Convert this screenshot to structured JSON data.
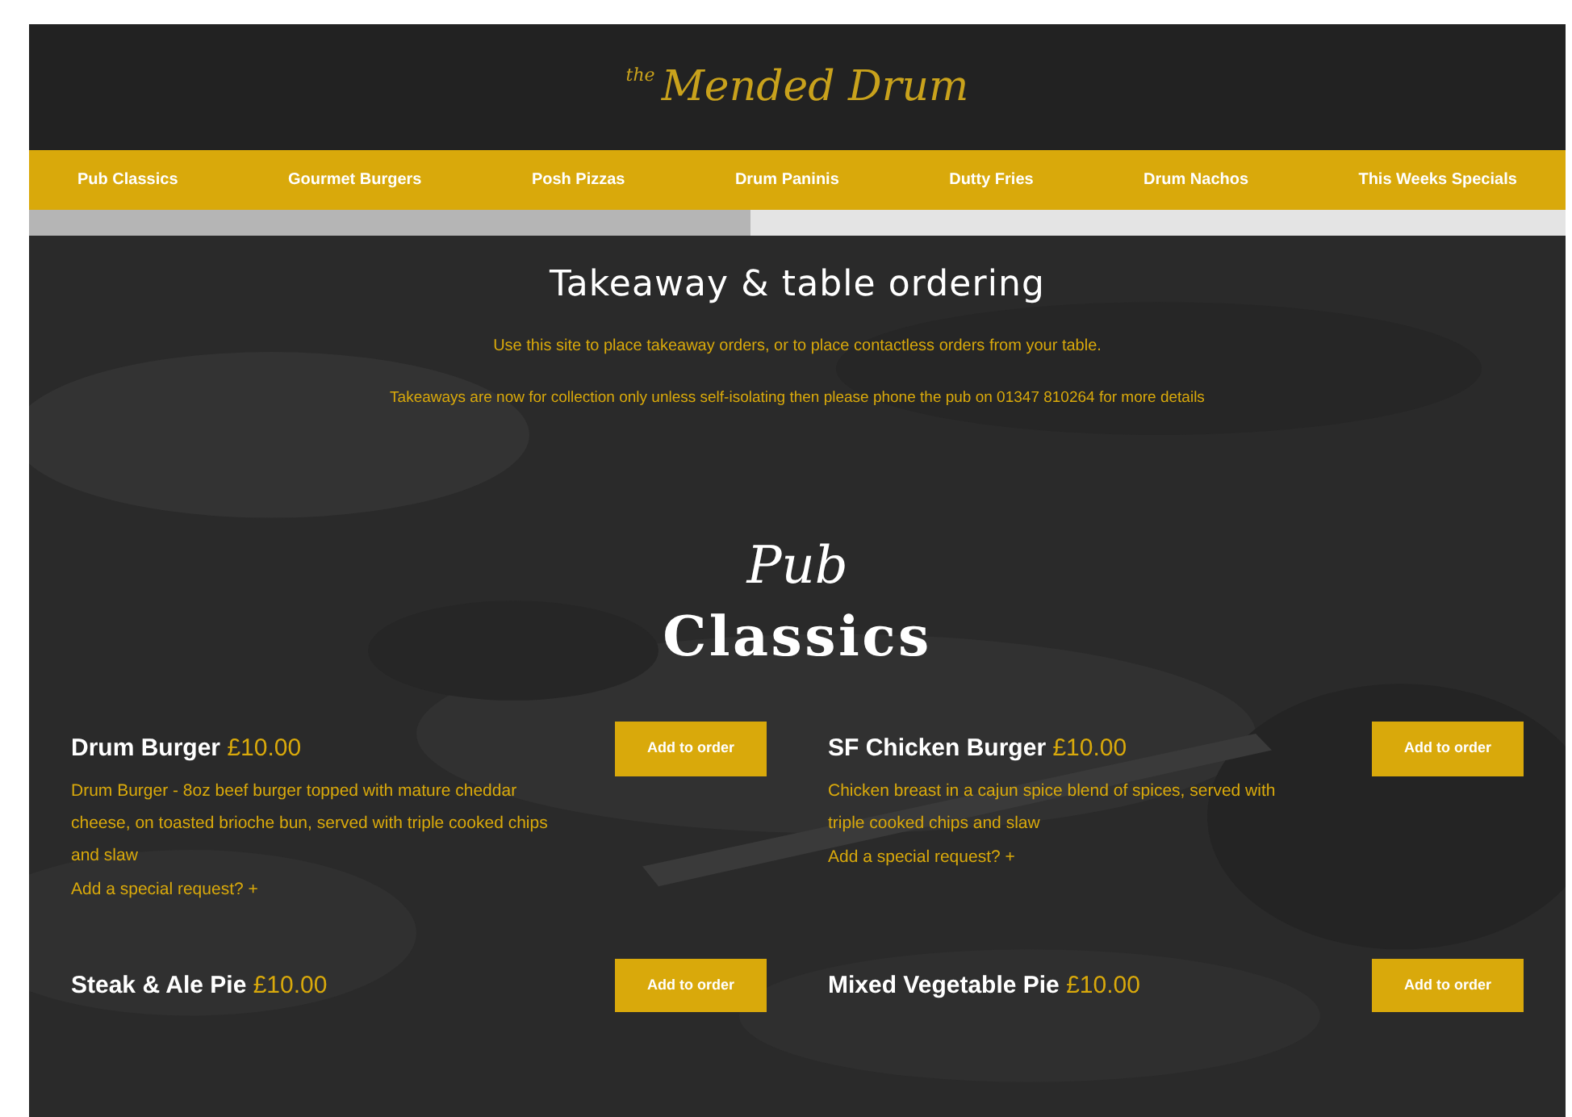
{
  "logo": {
    "small": "the",
    "name": "Mended Drum"
  },
  "nav": [
    {
      "label": "Pub Classics"
    },
    {
      "label": "Gourmet Burgers"
    },
    {
      "label": "Posh Pizzas"
    },
    {
      "label": "Drum Paninis"
    },
    {
      "label": "Dutty Fries"
    },
    {
      "label": "Drum Nachos"
    },
    {
      "label": "This Weeks Specials"
    }
  ],
  "progress": {
    "level": 0.47
  },
  "intro": {
    "title": "Takeaway & table ordering",
    "lines": [
      "Use this site to place takeaway orders, or to place contactless orders from your table.",
      "Takeaways are now for collection only unless self-isolating then please phone the pub on 01347 810264 for more details"
    ]
  },
  "section": {
    "script": "Pub",
    "title": "Classics"
  },
  "items": [
    {
      "name": "Drum Burger",
      "price": "£10.00",
      "description": "Drum Burger - 8oz beef burger topped with mature cheddar cheese, on toasted brioche bun, served with triple cooked chips and slaw",
      "request": "Add a special request? +",
      "button": "Add to order"
    },
    {
      "name": "SF Chicken Burger",
      "price": "£10.00",
      "description": "Chicken breast in a cajun spice blend of spices, served with triple cooked chips and slaw",
      "request": "Add a special request? +",
      "button": "Add to order"
    },
    {
      "name": "Steak & Ale Pie",
      "price": "£10.00",
      "button": "Add to order"
    },
    {
      "name": "Mixed Vegetable Pie",
      "price": "£10.00",
      "button": "Add to order"
    }
  ]
}
